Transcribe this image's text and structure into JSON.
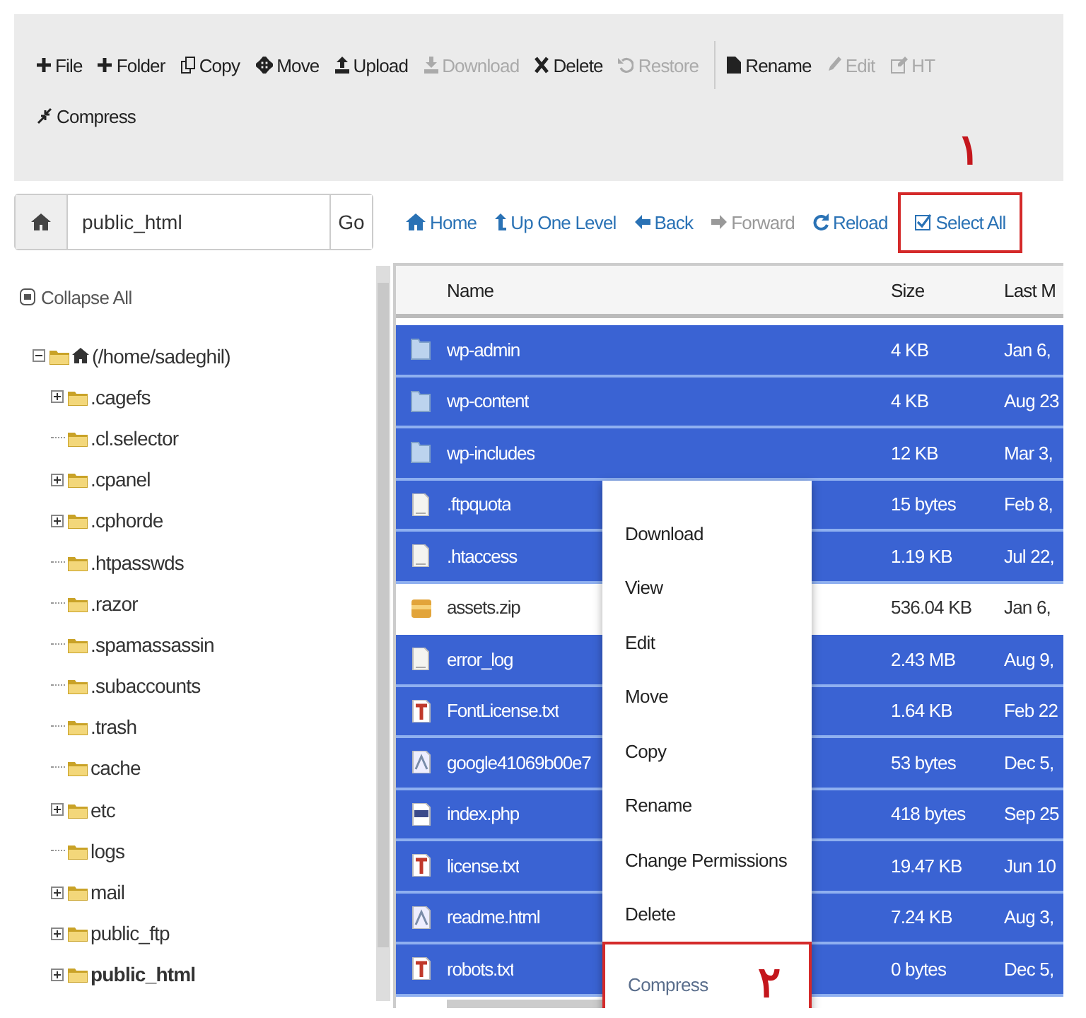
{
  "toolbar": {
    "items": [
      {
        "label": "File",
        "disabled": false
      },
      {
        "label": "Folder",
        "disabled": false
      },
      {
        "label": "Copy",
        "disabled": false
      },
      {
        "label": "Move",
        "disabled": false
      },
      {
        "label": "Upload",
        "disabled": false
      },
      {
        "label": "Download",
        "disabled": true
      },
      {
        "label": "Delete",
        "disabled": false
      },
      {
        "label": "Restore",
        "disabled": true
      },
      {
        "label": "Rename",
        "disabled": false
      },
      {
        "label": "Edit",
        "disabled": true
      },
      {
        "label": "HT",
        "disabled": true
      },
      {
        "label": "Compress",
        "disabled": false
      }
    ]
  },
  "path_bar": {
    "value": "public_html",
    "button": "Go"
  },
  "nav": [
    {
      "label": "Home",
      "disabled": false,
      "highlighted": false
    },
    {
      "label": "Up One Level",
      "disabled": false,
      "highlighted": false
    },
    {
      "label": "Back",
      "disabled": false,
      "highlighted": false
    },
    {
      "label": "Forward",
      "disabled": true,
      "highlighted": false
    },
    {
      "label": "Reload",
      "disabled": false,
      "highlighted": false
    },
    {
      "label": "Select All",
      "disabled": false,
      "highlighted": true,
      "annotation": "۱"
    }
  ],
  "tree": {
    "collapse_all": "Collapse All",
    "root": {
      "label": "(/home/sadeghil)",
      "expanded": true,
      "children": [
        {
          "label": ".cagefs",
          "expanded": false,
          "selected": false
        },
        {
          "label": ".cl.selector",
          "selected": false
        },
        {
          "label": ".cpanel",
          "expanded": false,
          "selected": false
        },
        {
          "label": ".cphorde",
          "expanded": false,
          "selected": false
        },
        {
          "label": ".htpasswds",
          "selected": false
        },
        {
          "label": ".razor",
          "selected": false
        },
        {
          "label": ".spamassassin",
          "selected": false
        },
        {
          "label": ".subaccounts",
          "selected": false
        },
        {
          "label": ".trash",
          "selected": false
        },
        {
          "label": "cache",
          "selected": false
        },
        {
          "label": "etc",
          "expanded": false,
          "selected": false
        },
        {
          "label": "logs",
          "selected": false
        },
        {
          "label": "mail",
          "expanded": false,
          "selected": false
        },
        {
          "label": "public_ftp",
          "expanded": false,
          "selected": false
        },
        {
          "label": "public_html",
          "expanded": false,
          "selected": true
        }
      ]
    }
  },
  "table": {
    "columns": [
      "Name",
      "Size",
      "Last M"
    ],
    "rows": [
      {
        "kind": "folder",
        "name": "wp-admin",
        "size": "4 KB",
        "modified": "Jan 6,",
        "selected": true
      },
      {
        "kind": "folder",
        "name": "wp-content",
        "size": "4 KB",
        "modified": "Aug 23",
        "selected": true
      },
      {
        "kind": "folder",
        "name": "wp-includes",
        "size": "12 KB",
        "modified": "Mar 3,",
        "selected": true
      },
      {
        "kind": "file",
        "name": ".ftpquota",
        "size": "15 bytes",
        "modified": "Feb 8,",
        "selected": true
      },
      {
        "kind": "file",
        "name": ".htaccess",
        "size": "1.19 KB",
        "modified": "Jul 22,",
        "selected": true
      },
      {
        "kind": "zip",
        "name": "assets.zip",
        "size": "536.04 KB",
        "modified": "Jan 6,",
        "selected": false
      },
      {
        "kind": "file",
        "name": "error_log",
        "size": "2.43 MB",
        "modified": "Aug 9,",
        "selected": true
      },
      {
        "kind": "text",
        "name": "FontLicense.txt",
        "size": "1.64 KB",
        "modified": "Feb 22",
        "selected": true
      },
      {
        "kind": "html",
        "name": "google41069b00e7",
        "size": "53 bytes",
        "modified": "Dec 5,",
        "selected": true
      },
      {
        "kind": "php",
        "name": "index.php",
        "size": "418 bytes",
        "modified": "Sep 25",
        "selected": true
      },
      {
        "kind": "text",
        "name": "license.txt",
        "size": "19.47 KB",
        "modified": "Jun 10",
        "selected": true
      },
      {
        "kind": "html",
        "name": "readme.html",
        "size": "7.24 KB",
        "modified": "Aug 3,",
        "selected": true
      },
      {
        "kind": "text",
        "name": "robots.txt",
        "size": "0 bytes",
        "modified": "Dec 5,",
        "selected": true
      }
    ]
  },
  "context_menu": {
    "items": [
      {
        "label": "Download",
        "highlighted": false
      },
      {
        "label": "View",
        "highlighted": false
      },
      {
        "label": "Edit",
        "highlighted": false
      },
      {
        "label": "Move",
        "highlighted": false
      },
      {
        "label": "Copy",
        "highlighted": false
      },
      {
        "label": "Rename",
        "highlighted": false
      },
      {
        "label": "Change Permissions",
        "highlighted": false
      },
      {
        "label": "Delete",
        "highlighted": false
      },
      {
        "label": "Compress",
        "highlighted": true,
        "annotation": "۲"
      }
    ]
  }
}
